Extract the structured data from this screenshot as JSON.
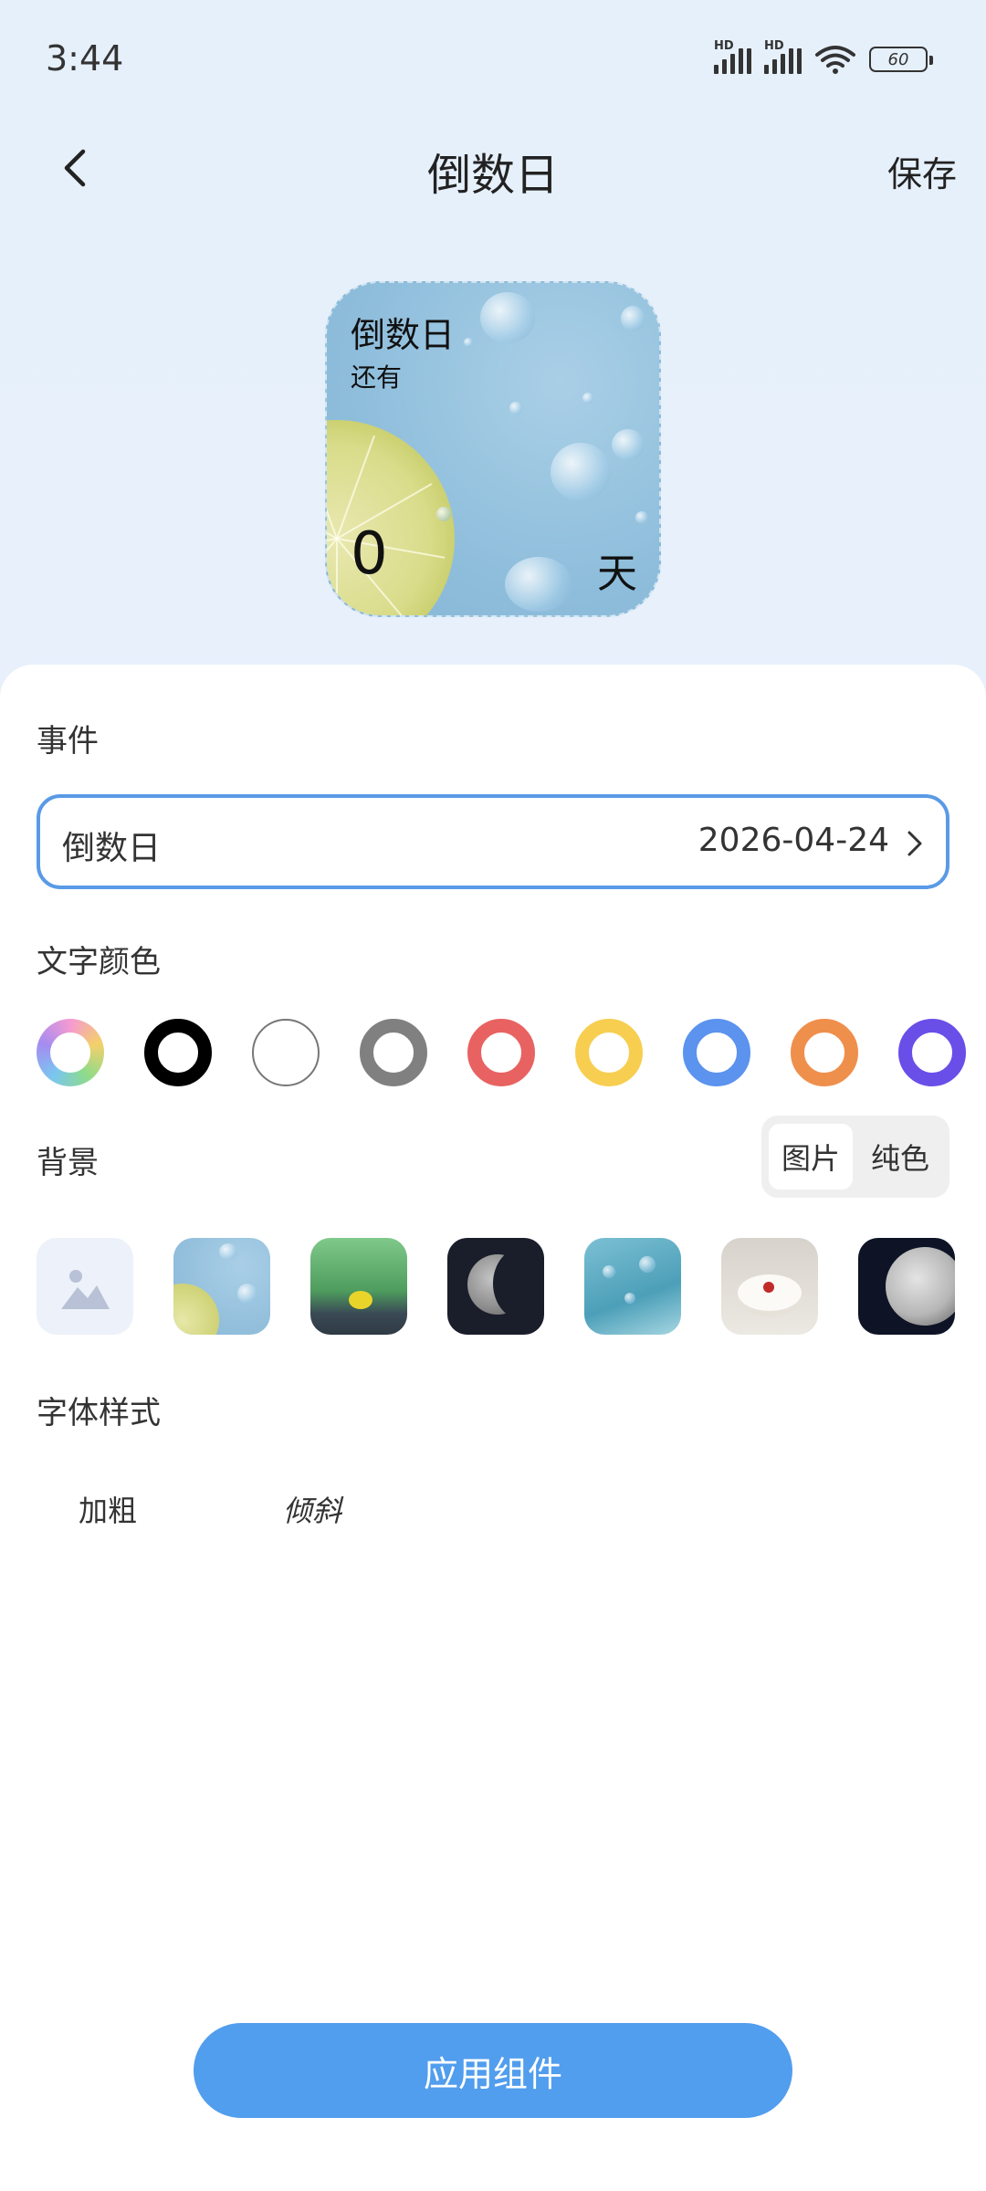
{
  "status_bar": {
    "time": "3:44",
    "battery": "60",
    "sim1_tag": "HD",
    "sim2_tag": "HD"
  },
  "header": {
    "title": "倒数日",
    "save_label": "保存"
  },
  "widget": {
    "title": "倒数日",
    "subtitle": "还有",
    "count": "0",
    "unit": "天"
  },
  "event": {
    "section_label": "事件",
    "name": "倒数日",
    "date": "2026-04-24"
  },
  "text_color": {
    "section_label": "文字颜色",
    "options": [
      {
        "name": "custom-rainbow",
        "color": "rainbow"
      },
      {
        "name": "black",
        "color": "#000000"
      },
      {
        "name": "white",
        "color": "#ffffff"
      },
      {
        "name": "gray",
        "color": "#808080"
      },
      {
        "name": "red",
        "color": "#e86262"
      },
      {
        "name": "yellow",
        "color": "#f7ce50"
      },
      {
        "name": "blue",
        "color": "#5b93ee"
      },
      {
        "name": "orange",
        "color": "#ef8f4c"
      },
      {
        "name": "purple",
        "color": "#6a4ee8"
      }
    ]
  },
  "background": {
    "section_label": "背景",
    "mode_options": [
      "图片",
      "纯色"
    ],
    "selected_mode": "图片",
    "thumbnails": [
      "add-image",
      "lemon-water-drops",
      "green-flower",
      "moon",
      "ocean-drops",
      "cake",
      "moon-night"
    ]
  },
  "font_style": {
    "section_label": "字体样式",
    "bold_label": "加粗",
    "italic_label": "倾斜"
  },
  "apply_button": "应用组件",
  "accent_color": "#519dee"
}
